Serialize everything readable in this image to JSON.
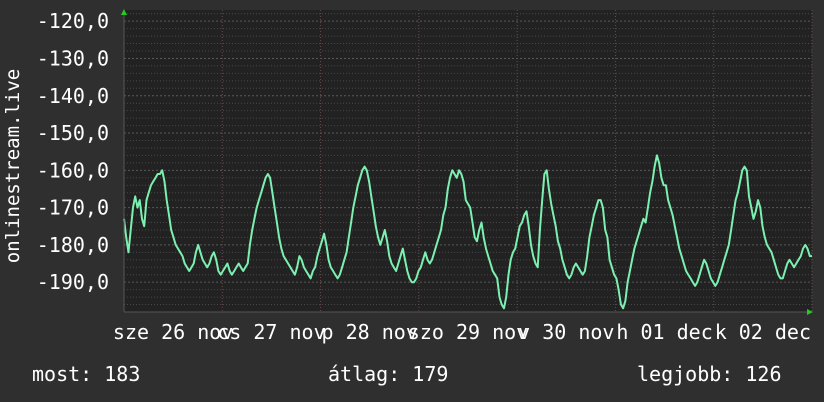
{
  "chart_data": {
    "type": "line",
    "ylabel": "onlinestream.live",
    "xlabel": "",
    "ylim": [
      -198,
      -117
    ],
    "y_ticks": [
      "-120,0",
      "-130,0",
      "-140,0",
      "-150,0",
      "-160,0",
      "-170,0",
      "-180,0",
      "-190,0"
    ],
    "y_tick_values": [
      -120,
      -130,
      -140,
      -150,
      -160,
      -170,
      -180,
      -190
    ],
    "x_ticks": [
      "sze 26 nov",
      "cs 27 nov",
      "p 28 nov",
      "szo 29 nov",
      "v 30 nov",
      "h 01 dec",
      "k 02 dec"
    ],
    "grid": true,
    "colors": {
      "background": "#2f2f2f",
      "plot_area": "#222222",
      "line": "#7cf0b0",
      "grid_major": "#5a5a5a",
      "grid_minor": "#484848",
      "grid_vertical": "#6a4a4a",
      "axis_arrow": "#22cc22"
    },
    "series": [
      {
        "x_start": 0,
        "x_end": 7,
        "values": [
          -173,
          -178,
          -182,
          -176,
          -170,
          -167,
          -170,
          -168,
          -173,
          -175,
          -168,
          -166,
          -164,
          -163,
          -162,
          -161,
          -161,
          -160,
          -163,
          -168,
          -172,
          -176,
          -178,
          -180,
          -181,
          -182,
          -183,
          -185,
          -186,
          -187,
          -186,
          -185,
          -182,
          -180,
          -182,
          -184,
          -185,
          -186,
          -185,
          -183,
          -182,
          -184,
          -187,
          -188,
          -187,
          -186,
          -185,
          -187,
          -188,
          -187,
          -186,
          -185,
          -186,
          -187,
          -186,
          -185,
          -180,
          -176,
          -173,
          -170,
          -168,
          -166,
          -164,
          -162,
          -161,
          -162,
          -166,
          -170,
          -174,
          -178,
          -181,
          -183,
          -184,
          -185,
          -186,
          -187,
          -188,
          -186,
          -183,
          -184,
          -186,
          -187,
          -188,
          -189,
          -187,
          -186,
          -183,
          -181,
          -179,
          -177,
          -180,
          -184,
          -186,
          -187,
          -188,
          -189,
          -188,
          -186,
          -184,
          -182,
          -178,
          -174,
          -170,
          -167,
          -164,
          -162,
          -160,
          -159,
          -160,
          -163,
          -167,
          -171,
          -175,
          -178,
          -180,
          -178,
          -176,
          -179,
          -183,
          -185,
          -186,
          -187,
          -185,
          -183,
          -181,
          -184,
          -187,
          -189,
          -190,
          -190,
          -189,
          -187,
          -186,
          -184,
          -182,
          -184,
          -185,
          -184,
          -182,
          -180,
          -178,
          -176,
          -172,
          -170,
          -165,
          -162,
          -160,
          -161,
          -162,
          -160,
          -161,
          -163,
          -168,
          -169,
          -170,
          -174,
          -178,
          -179,
          -176,
          -174,
          -178,
          -181,
          -183,
          -185,
          -187,
          -188,
          -189,
          -194,
          -196,
          -197,
          -194,
          -188,
          -184,
          -182,
          -181,
          -178,
          -175,
          -174,
          -172,
          -171,
          -175,
          -180,
          -183,
          -185,
          -186,
          -176,
          -168,
          -161,
          -160,
          -165,
          -169,
          -172,
          -175,
          -179,
          -181,
          -184,
          -186,
          -188,
          -189,
          -188,
          -186,
          -185,
          -186,
          -187,
          -188,
          -187,
          -183,
          -178,
          -175,
          -172,
          -170,
          -168,
          -168,
          -170,
          -176,
          -178,
          -184,
          -186,
          -188,
          -189,
          -192,
          -196,
          -197,
          -195,
          -190,
          -187,
          -184,
          -181,
          -179,
          -177,
          -175,
          -173,
          -174,
          -170,
          -166,
          -163,
          -159,
          -156,
          -158,
          -162,
          -164,
          -164,
          -168,
          -170,
          -172,
          -175,
          -178,
          -181,
          -183,
          -185,
          -187,
          -188,
          -189,
          -190,
          -191,
          -190,
          -188,
          -186,
          -184,
          -185,
          -187,
          -189,
          -190,
          -191,
          -190,
          -188,
          -186,
          -184,
          -182,
          -180,
          -176,
          -172,
          -168,
          -166,
          -163,
          -160,
          -159,
          -160,
          -167,
          -170,
          -173,
          -171,
          -168,
          -170,
          -175,
          -178,
          -180,
          -181,
          -182,
          -184,
          -186,
          -188,
          -189,
          -189,
          -187,
          -185,
          -184,
          -185,
          -186,
          -185,
          -184,
          -183,
          -181,
          -180,
          -181,
          -183,
          -183
        ]
      }
    ],
    "stats": {
      "now_label": "most:",
      "now_value": "183",
      "avg_label": "átlag:",
      "avg_value": "179",
      "best_label": "legjobb:",
      "best_value": "126"
    }
  }
}
